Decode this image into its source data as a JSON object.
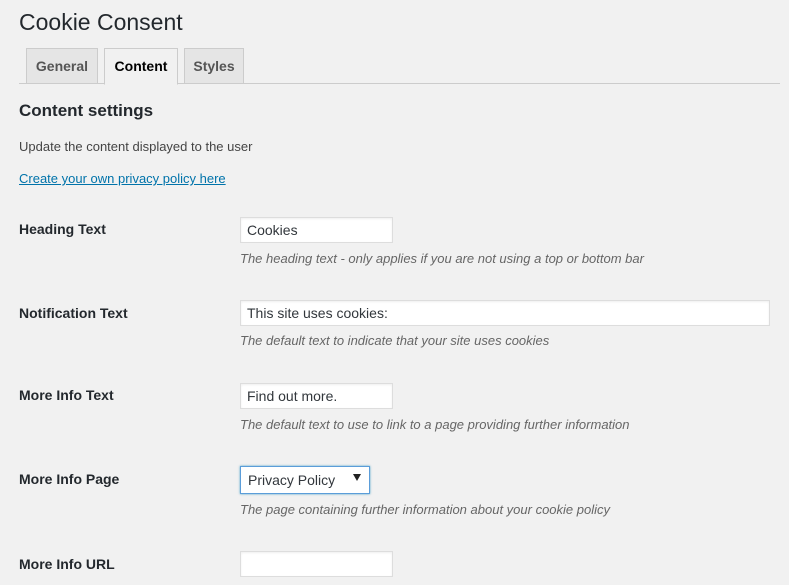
{
  "page": {
    "title": "Cookie Consent"
  },
  "tabs": [
    {
      "label": "General",
      "active": false
    },
    {
      "label": "Content",
      "active": true
    },
    {
      "label": "Styles",
      "active": false
    }
  ],
  "section": {
    "title": "Content settings",
    "description": "Update the content displayed to the user",
    "link_text": "Create your own privacy policy here"
  },
  "fields": {
    "heading_text": {
      "label": "Heading Text",
      "value": "Cookies",
      "description": "The heading text - only applies if you are not using a top or bottom bar"
    },
    "notification_text": {
      "label": "Notification Text",
      "value": "This site uses cookies:",
      "description": "The default text to indicate that your site uses cookies"
    },
    "more_info_text": {
      "label": "More Info Text",
      "value": "Find out more.",
      "description": "The default text to use to link to a page providing further information"
    },
    "more_info_page": {
      "label": "More Info Page",
      "selected": "Privacy Policy",
      "description": "The page containing further information about your cookie policy"
    },
    "more_info_url": {
      "label": "More Info URL",
      "value": ""
    }
  },
  "colors": {
    "background": "#f1f1f1",
    "link": "#0073aa",
    "focus_border": "#5b9dd9"
  }
}
